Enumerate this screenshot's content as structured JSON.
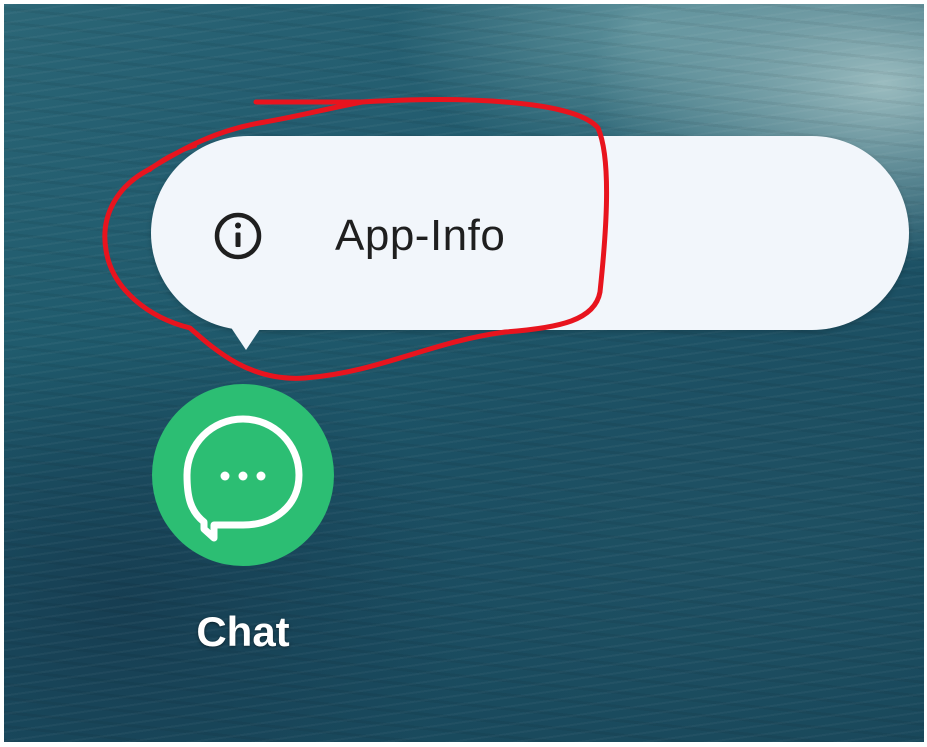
{
  "popup_menu": {
    "items": [
      {
        "label": "App-Info",
        "icon": "info-icon"
      }
    ]
  },
  "home_screen": {
    "apps": [
      {
        "label": "Chat",
        "icon": "chat-bubble-icon",
        "icon_color": "#2cbe73"
      }
    ]
  },
  "annotation": {
    "color": "#e8141e",
    "shape": "hand-drawn-circle"
  },
  "colors": {
    "popup_background": "#f2f6fb",
    "label_text": "#1f1f1f",
    "wallpaper": "#1f5a6c"
  }
}
